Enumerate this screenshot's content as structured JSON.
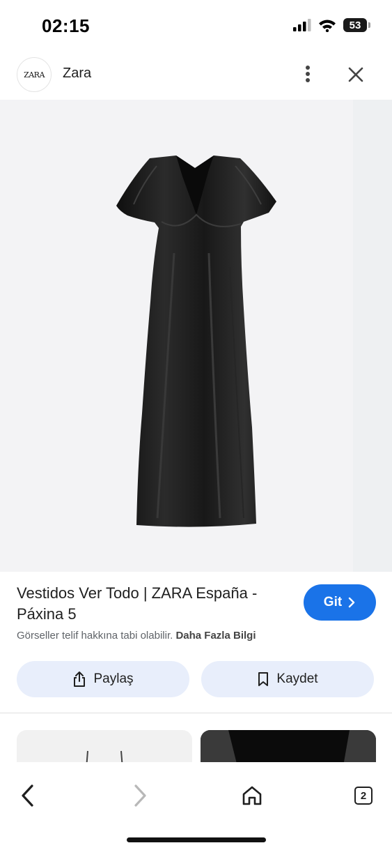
{
  "status_bar": {
    "time": "02:15",
    "battery": "53"
  },
  "header": {
    "logo_text": "ZARA",
    "site_name": "Zara"
  },
  "result": {
    "title": "Vestidos Ver Todo | ZARA España - Páxina 5",
    "go_label": "Git",
    "copyright_text": "Görseller telif hakkına tabi olabilir.",
    "more_info_label": "Daha Fazla Bilgi"
  },
  "actions": {
    "share_label": "Paylaş",
    "save_label": "Kaydet"
  },
  "bottom_nav": {
    "tabs_count": "2"
  },
  "colors": {
    "accent": "#1a73e8",
    "action_bg": "#e8eefb",
    "image_bg": "#f3f3f5"
  },
  "icons": [
    "signal-icon",
    "wifi-icon",
    "battery-icon",
    "more-vert-icon",
    "close-icon",
    "chevron-right-icon",
    "share-icon",
    "bookmark-icon",
    "back-icon",
    "forward-icon",
    "home-icon",
    "tabs-icon"
  ]
}
